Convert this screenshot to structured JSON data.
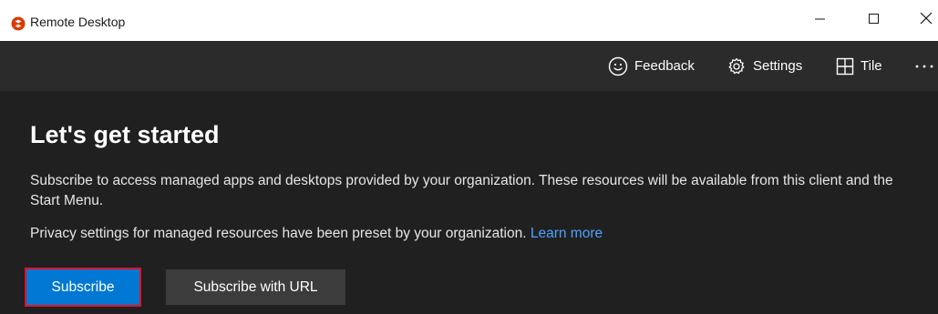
{
  "window": {
    "title": "Remote Desktop",
    "icon": "remote-desktop-app-icon",
    "controls": [
      "minimize-icon",
      "maximize-icon",
      "close-icon"
    ]
  },
  "toolbar": {
    "feedback_label": "Feedback",
    "settings_label": "Settings",
    "tile_label": "Tile",
    "more_label": "..."
  },
  "main": {
    "heading": "Let's get started",
    "description": "Subscribe to access managed apps and desktops provided by your organization. These resources will be available from this client and the Start Menu.",
    "privacy_text": "Privacy settings for managed resources have been preset by your organization.",
    "learn_more_label": "Learn more",
    "subscribe_label": "Subscribe",
    "subscribe_url_label": "Subscribe with URL"
  },
  "colors": {
    "accent": "#0078d4",
    "link": "#4ea1ff",
    "highlight_border": "#e81123",
    "background": "#202020",
    "toolbar": "#2b2b2b"
  }
}
